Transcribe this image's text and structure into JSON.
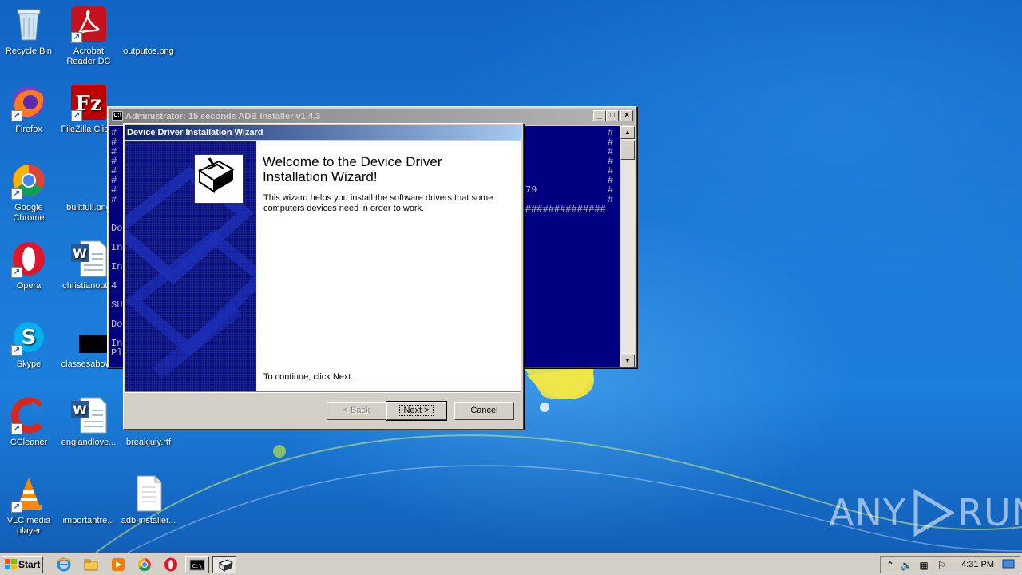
{
  "desktop": {
    "icons": [
      {
        "label": "Recycle Bin"
      },
      {
        "label": "Acrobat Reader DC",
        "line1": "Acrobat",
        "line2": "Reader DC"
      },
      {
        "label": "outputos.png"
      },
      {
        "label": "Firefox"
      },
      {
        "label": "FileZilla Clie..."
      },
      {
        "label": "Google Chrome",
        "line1": "Google",
        "line2": "Chrome"
      },
      {
        "label": "builtfull.png"
      },
      {
        "label": "Opera"
      },
      {
        "label": "christianout..."
      },
      {
        "label": "Skype"
      },
      {
        "label": "classesabov..."
      },
      {
        "label": "CCleaner"
      },
      {
        "label": "englandlove..."
      },
      {
        "label": "breakjuly.rtf"
      },
      {
        "label": "VLC media player",
        "line1": "VLC media",
        "line2": "player"
      },
      {
        "label": "importantre..."
      },
      {
        "label": "adb-installer..."
      }
    ]
  },
  "console": {
    "title": "Administrator:  15 seconds ADB Installer v1.4.3",
    "lines": {
      "l1": "Do",
      "l2": "In",
      "l3": "In",
      "l4": "4",
      "l5": "SU",
      "l6": "Do",
      "l7": "In",
      "l8": "Pl",
      "version_fragment": "79",
      "hash_row": "##############",
      "hash": "#"
    }
  },
  "wizard": {
    "title": "Device Driver Installation Wizard",
    "heading": "Welcome to the Device Driver Installation Wizard!",
    "description": "This wizard helps you install the software drivers that some computers devices need in order to work.",
    "continue_text": "To continue, click Next.",
    "buttons": {
      "back": "< Back",
      "next": "Next >",
      "cancel": "Cancel"
    }
  },
  "watermark": {
    "left": "ANY",
    "right": "RUN"
  },
  "taskbar": {
    "start_label": "Start",
    "clock": "4:31 PM"
  }
}
